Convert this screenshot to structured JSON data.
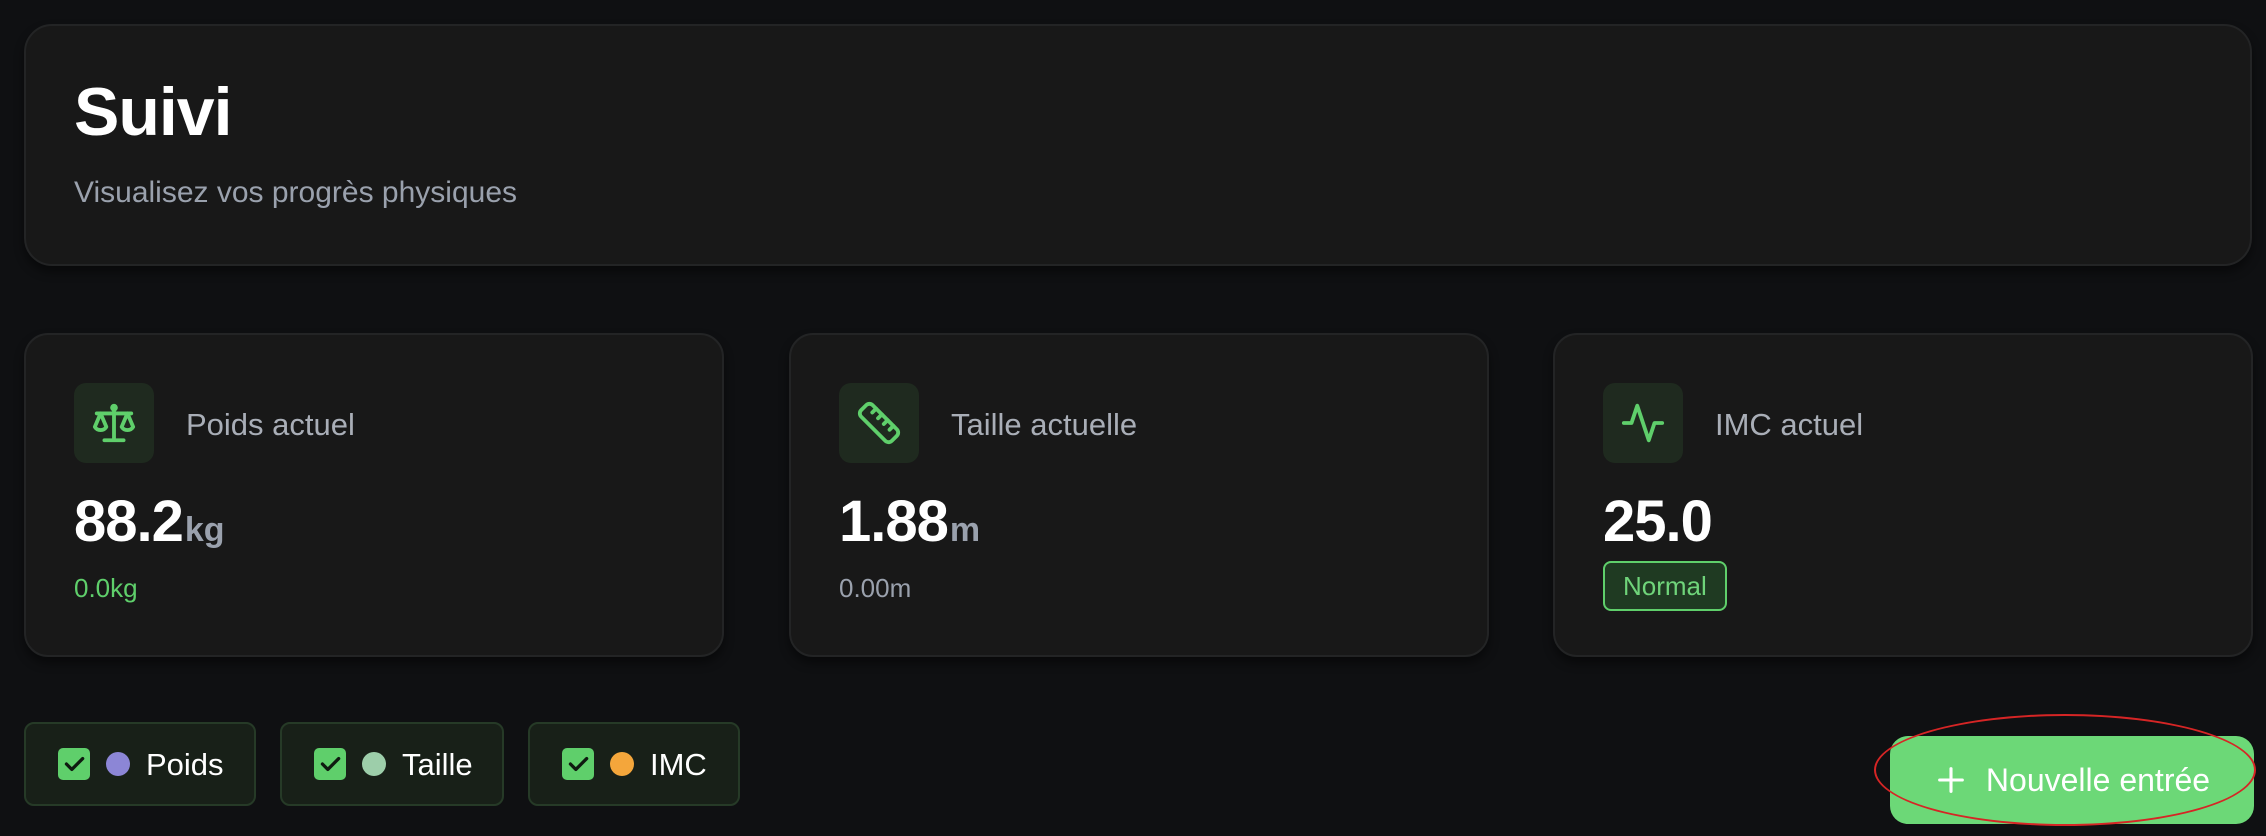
{
  "header": {
    "title": "Suivi",
    "subtitle": "Visualisez vos progrès physiques"
  },
  "stats": {
    "weight": {
      "icon": "scale-icon",
      "label": "Poids actuel",
      "value": "88.2",
      "unit": "kg",
      "delta": "0.0kg"
    },
    "height": {
      "icon": "ruler-icon",
      "label": "Taille actuelle",
      "value": "1.88",
      "unit": "m",
      "delta": "0.00m"
    },
    "bmi": {
      "icon": "activity-icon",
      "label": "IMC actuel",
      "value": "25.0",
      "status": "Normal"
    }
  },
  "filters": [
    {
      "label": "Poids",
      "checked": true,
      "color": "#8c86d6"
    },
    {
      "label": "Taille",
      "checked": true,
      "color": "#9dceaa"
    },
    {
      "label": "IMC",
      "checked": true,
      "color": "#f4a63b"
    }
  ],
  "actions": {
    "new_entry_label": "Nouvelle entrée",
    "new_entry_icon": "plus-icon"
  },
  "colors": {
    "accent": "#5fcf6b",
    "background": "#0f1012",
    "card": "#181818"
  }
}
